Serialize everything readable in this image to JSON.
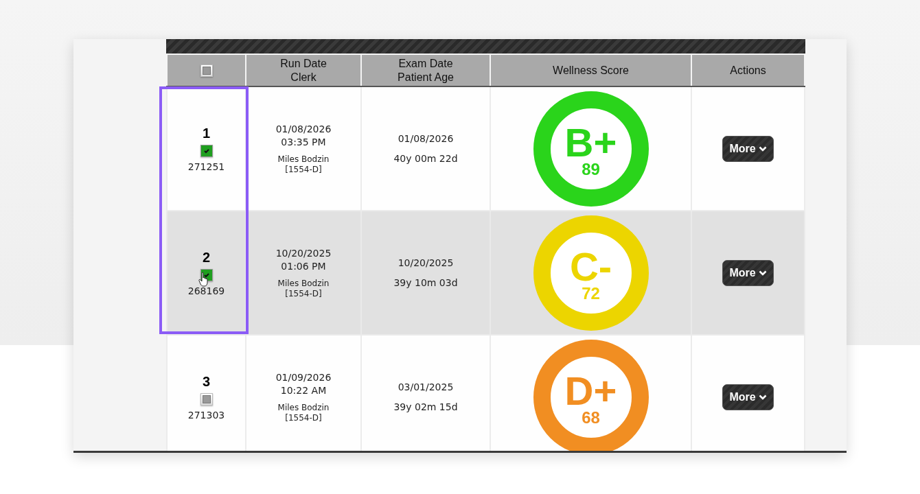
{
  "table": {
    "columns": [
      {
        "kind": "checkbox",
        "checked": false
      },
      {
        "kind": "text",
        "lines": [
          "Run Date",
          "Clerk"
        ]
      },
      {
        "kind": "text",
        "lines": [
          "Exam Date",
          "Patient Age"
        ]
      },
      {
        "kind": "text",
        "lines": [
          "Wellness Score"
        ]
      },
      {
        "kind": "text",
        "lines": [
          "Actions"
        ]
      }
    ],
    "rows": [
      {
        "number": "1",
        "checked": true,
        "id": "271251",
        "run_date": "01/08/2026",
        "run_time": "03:35 PM",
        "clerk": "Miles Bodzin",
        "clerk_code": "[1554-D]",
        "exam_date": "01/08/2026",
        "patient_age": "40y 00m 22d",
        "grade": "B+",
        "score": "89",
        "color": "#2ad41b",
        "action": "More"
      },
      {
        "number": "2",
        "checked": true,
        "id": "268169",
        "run_date": "10/20/2025",
        "run_time": "01:06 PM",
        "clerk": "Miles Bodzin",
        "clerk_code": "[1554-D]",
        "exam_date": "10/20/2025",
        "patient_age": "39y 10m 03d",
        "grade": "C-",
        "score": "72",
        "color": "#ecd500",
        "action": "More"
      },
      {
        "number": "3",
        "checked": false,
        "id": "271303",
        "run_date": "01/09/2026",
        "run_time": "10:22 AM",
        "clerk": "Miles Bodzin",
        "clerk_code": "[1554-D]",
        "exam_date": "03/01/2025",
        "patient_age": "39y 02m 15d",
        "grade": "D+",
        "score": "68",
        "color": "#f18e22",
        "action": "More"
      }
    ]
  }
}
